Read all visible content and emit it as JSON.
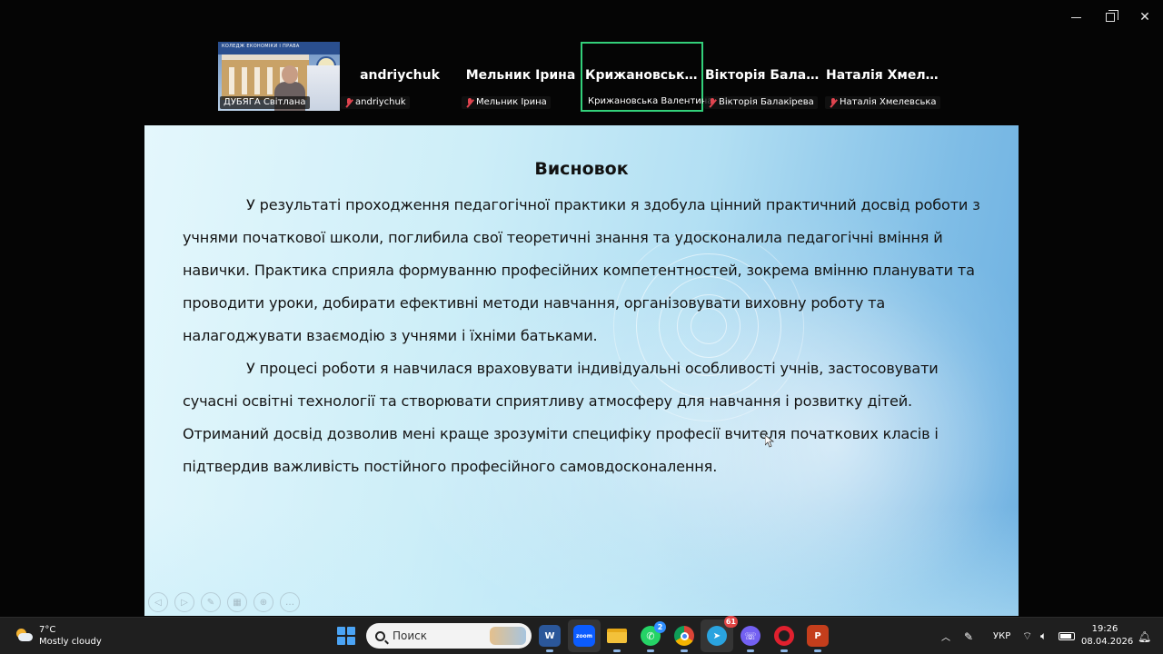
{
  "window_controls": {
    "minimize_icon": "minimize-icon",
    "maximize_icon": "restore-icon",
    "close_icon": "close-icon"
  },
  "participants": {
    "video_tile": {
      "name": "ДУБЯГА Світлана",
      "banner_text": "КОЛЕДЖ ЕКОНОМІКИ І ПРАВА"
    },
    "tiles": [
      {
        "display_name": "andriychuk",
        "chip_name": "andriychuk",
        "muted": true
      },
      {
        "display_name": "Мельник Ірина",
        "chip_name": "Мельник Ірина",
        "muted": true
      },
      {
        "display_name": "Крижановська...",
        "chip_name": "Крижановська Валентина",
        "muted": false,
        "active_speaker": true
      },
      {
        "display_name": "Вікторія Балакі...",
        "chip_name": "Вікторія Балакірева",
        "muted": true
      },
      {
        "display_name": "Наталія Хмеле...",
        "chip_name": "Наталія Хмелевська",
        "muted": true
      }
    ],
    "active_speaker_color": "#33d07a",
    "mute_color": "#e0444f"
  },
  "slide": {
    "title": "Висновок",
    "paragraph_1": "У результаті проходження педагогічної практики я здобула цінний практичний досвід роботи з учнями початкової школи, поглибила свої теоретичні знання та удосконалила педагогічні вміння й навички. Практика сприяла формуванню професійних компетентностей, зокрема вмінню планувати та проводити уроки, добирати ефективні методи навчання, організовувати виховну роботу та налагоджувати взаємодію з учнями і їхніми батьками.",
    "paragraph_2": "У процесі роботи я навчилася враховувати індивідуальні особливості учнів, застосовувати сучасні освітні технології та створювати сприятливу атмосферу для навчання і розвитку дітей. Отриманий досвід дозволив мені краще зрозуміти специфіку професії вчителя початкових класів і підтвердив важливість постійного професійного самовдосконалення.",
    "tools": [
      "prev-icon",
      "next-icon",
      "pen-icon",
      "slides-icon",
      "zoom-icon",
      "more-icon"
    ]
  },
  "taskbar": {
    "weather": {
      "temp": "7°C",
      "condition": "Mostly cloudy"
    },
    "search_placeholder": "Поиск",
    "apps": [
      {
        "name": "start-icon"
      },
      {
        "name": "word-icon",
        "label": "W"
      },
      {
        "name": "zoom-icon",
        "label": "zoom"
      },
      {
        "name": "file-explorer-icon"
      },
      {
        "name": "whatsapp-icon",
        "badge": "2"
      },
      {
        "name": "chrome-icon"
      },
      {
        "name": "telegram-icon",
        "badge": "61"
      },
      {
        "name": "viber-icon"
      },
      {
        "name": "opera-icon"
      },
      {
        "name": "powerpoint-icon",
        "label": "P"
      }
    ],
    "tray": {
      "language": "УКР"
    },
    "clock": {
      "time": "19:26",
      "date": "08.04.2026"
    }
  }
}
